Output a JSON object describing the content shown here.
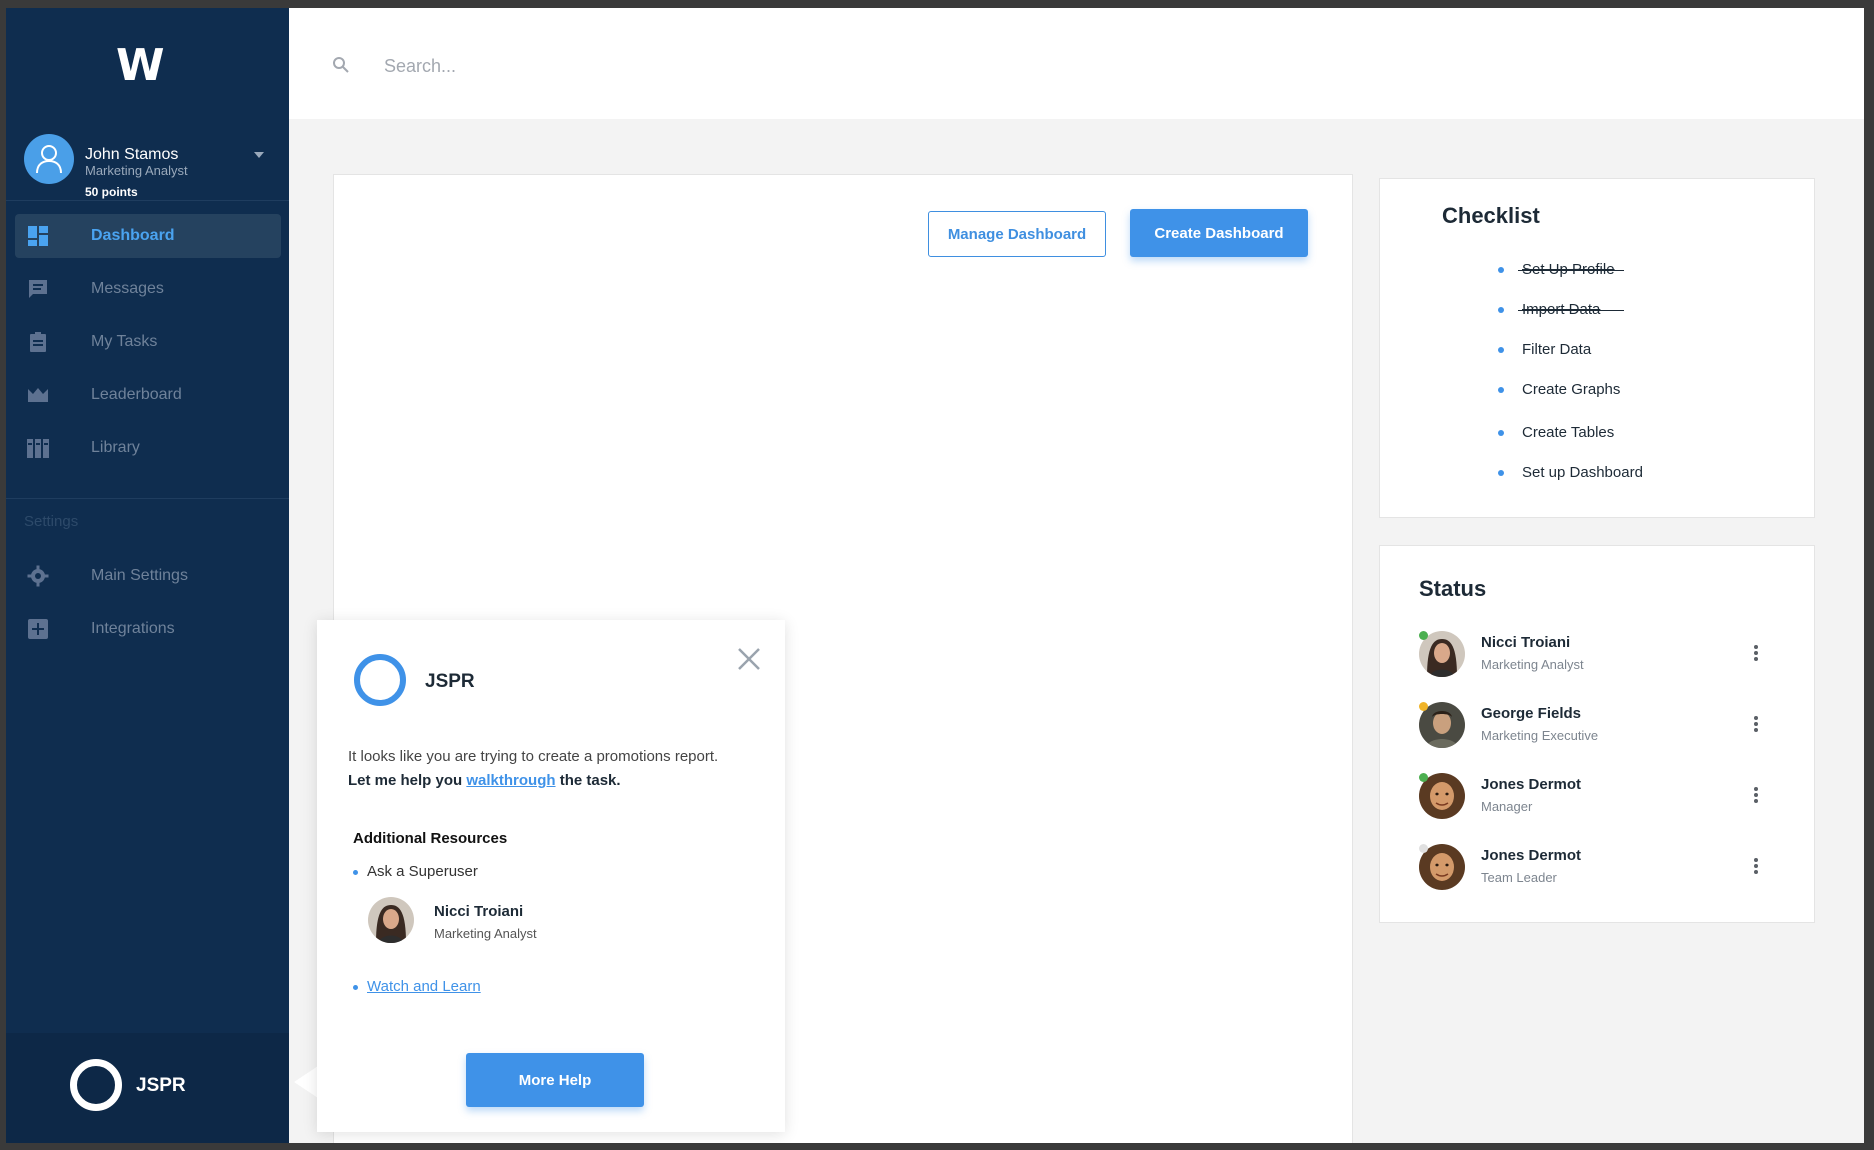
{
  "app": {
    "logo": "W",
    "accent": "#3f92e8",
    "sidebar_bg": "#0f2d4f"
  },
  "user": {
    "name": "John Stamos",
    "role": "Marketing Analyst",
    "points": "50 points"
  },
  "nav": {
    "items": [
      {
        "label": "Dashboard",
        "icon": "dashboard-icon",
        "active": true
      },
      {
        "label": "Messages",
        "icon": "chat-icon"
      },
      {
        "label": "My Tasks",
        "icon": "clipboard-icon"
      },
      {
        "label": "Leaderboard",
        "icon": "crown-icon"
      },
      {
        "label": "Library",
        "icon": "library-icon"
      }
    ],
    "settings_label": "Settings",
    "settings_items": [
      {
        "label": "Main Settings",
        "icon": "gear-icon"
      },
      {
        "label": "Integrations",
        "icon": "plus-square-icon"
      }
    ]
  },
  "footer": {
    "label": "JSPR"
  },
  "search": {
    "placeholder": "Search..."
  },
  "main": {
    "manage_label": "Manage Dashboard",
    "create_label": "Create Dashboard"
  },
  "checklist": {
    "title": "Checklist",
    "items": [
      {
        "label": "Set Up Profile",
        "done": true
      },
      {
        "label": "Import Data",
        "done": true
      },
      {
        "label": "Filter Data",
        "done": false
      },
      {
        "label": "Create Graphs",
        "done": false
      },
      {
        "label": "Create Tables",
        "done": false
      },
      {
        "label": "Set up Dashboard",
        "done": false
      }
    ]
  },
  "status": {
    "title": "Status",
    "people": [
      {
        "name": "Nicci Troiani",
        "role": "Marketing Analyst",
        "dot": "#4caf50"
      },
      {
        "name": "George Fields",
        "role": "Marketing Executive",
        "dot": "#f0b429"
      },
      {
        "name": "Jones Dermot",
        "role": "Manager",
        "dot": "#4caf50"
      },
      {
        "name": "Jones Dermot",
        "role": "Team Leader",
        "dot": "#e0e0e0"
      }
    ]
  },
  "popup": {
    "title": "JSPR",
    "message_line1": "It looks like you are trying to create a promotions report.",
    "message_pre": "Let me help you ",
    "message_link": "walkthrough",
    "message_post": " the task.",
    "resources_title": "Additional Resources",
    "ask_label": "Ask a Superuser",
    "superuser_name": "Nicci Troiani",
    "superuser_role": "Marketing Analyst",
    "watch_label": "Watch and Learn",
    "button_label": "More Help"
  }
}
